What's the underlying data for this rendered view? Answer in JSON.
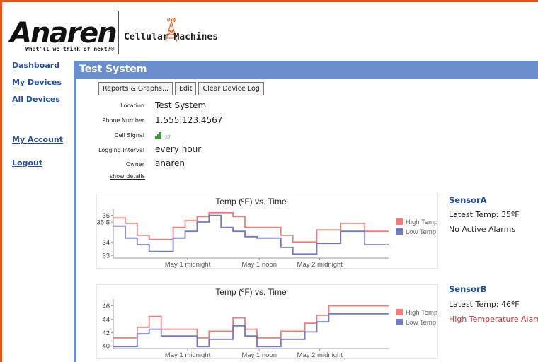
{
  "header": {
    "anaren_name": "Anaren",
    "anaren_reg": "®",
    "anaren_tagline": "What'll we think of next?®",
    "partner_name": "Cellular Machines"
  },
  "sidebar": {
    "items": [
      {
        "label": "Dashboard"
      },
      {
        "label": "My Devices"
      },
      {
        "label": "All Devices"
      },
      {
        "label": "My Account"
      },
      {
        "label": "Logout"
      }
    ]
  },
  "page": {
    "title": "Test System",
    "buttons": [
      "Reports & Graphs...",
      "Edit",
      "Clear Device Log"
    ]
  },
  "details": {
    "location_label": "Location",
    "location": "Test System",
    "phone_label": "Phone Number",
    "phone": "1.555.123.4567",
    "signal_label": "Cell Signal",
    "signal_value": "27",
    "interval_label": "Logging Interval",
    "interval": "every hour",
    "owner_label": "Owner",
    "owner": "anaren",
    "show_details": "show details"
  },
  "colors": {
    "high": "#f07d7d",
    "low": "#7579c0",
    "accent": "#6a8fcc",
    "link": "#2a4f9a",
    "alarm": "#d93030"
  },
  "sensors": [
    {
      "name": "SensorA",
      "latest": "Latest Temp: 35ºF",
      "alarm": "No Active Alarms",
      "alarm_active": false
    },
    {
      "name": "SensorB",
      "latest": "Latest Temp: 46ºF",
      "alarm": "High Temperature Alarm",
      "alarm_active": true
    }
  ],
  "chart_data": [
    {
      "type": "line",
      "step": true,
      "title": "Temp (ºF) vs. Time",
      "x_ticks": [
        "May 1 midnight",
        "May 1 noon",
        "May 2 midnight"
      ],
      "y_ticks": [
        "33",
        "34",
        "35.5",
        "36"
      ],
      "ylim": [
        32.8,
        36.4
      ],
      "series": [
        {
          "name": "High Temp",
          "values": [
            35.8,
            35.4,
            34.5,
            34.2,
            34.2,
            35.1,
            35.6,
            35.9,
            36.2,
            36.2,
            35.9,
            35.1,
            35.1,
            35.1,
            34.5,
            34.0,
            34.0,
            34.9,
            34.9,
            35.4,
            35.4,
            34.8,
            34.8
          ]
        },
        {
          "name": "Low Temp",
          "values": [
            35.2,
            34.3,
            33.8,
            33.3,
            33.3,
            34.3,
            34.8,
            35.5,
            36.0,
            35.1,
            34.8,
            34.4,
            34.3,
            34.3,
            33.6,
            33.1,
            33.1,
            33.9,
            33.9,
            34.8,
            34.8,
            33.8,
            33.8
          ]
        }
      ],
      "legend": "right"
    },
    {
      "type": "line",
      "step": true,
      "title": "Temp (ºF) vs. Time",
      "x_ticks": [
        "May 1 midnight",
        "May 1 noon",
        "May 2 midnight"
      ],
      "y_ticks": [
        "40",
        "42",
        "44",
        "46"
      ],
      "ylim": [
        39.6,
        46.8
      ],
      "series": [
        {
          "name": "High Temp",
          "values": [
            41.2,
            41.2,
            42.8,
            44.4,
            42.5,
            42.5,
            42.5,
            41.2,
            42.2,
            42.2,
            44.2,
            42.5,
            41.2,
            41.2,
            42.2,
            42.2,
            43.4,
            44.6,
            46.0,
            46.0,
            46.0,
            46.0,
            46.0
          ]
        },
        {
          "name": "Low Temp",
          "values": [
            39.9,
            39.9,
            41.8,
            42.5,
            41.5,
            41.5,
            41.5,
            39.9,
            41.0,
            41.0,
            43.0,
            41.5,
            39.9,
            39.9,
            41.0,
            41.0,
            42.1,
            43.6,
            44.8,
            44.8,
            44.8,
            44.8,
            44.8
          ]
        }
      ],
      "legend": "right"
    }
  ]
}
